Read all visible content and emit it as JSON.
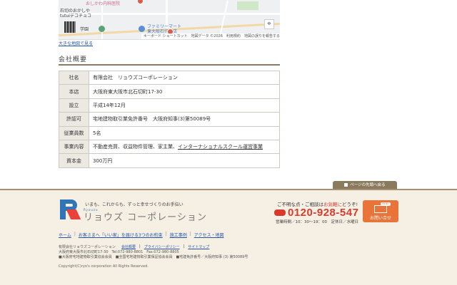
{
  "map": {
    "poi": {
      "shop1": "おしかわ内科医院",
      "shop2a": "石切のおかしや",
      "shop2b": "tutuiデコチョコ",
      "school": "学園",
      "mart_line1": "ファミリーマート",
      "mart_line2": "東大阪石切町店"
    },
    "controls": {
      "locate": "⌖"
    },
    "attribution": [
      "キーボード ショートカット",
      "地図データ ©2026",
      "利用規約",
      "地図の誤りを報告する"
    ]
  },
  "map_link": "大きな地図で見る",
  "section": {
    "title": "会社概要"
  },
  "company": [
    {
      "label": "社名",
      "value": "有限会社　リョウズコーポレーション"
    },
    {
      "label": "本店",
      "value": "大阪府東大阪市北石切町17-30"
    },
    {
      "label": "設立",
      "value": "平成14年12月"
    },
    {
      "label": "許認可",
      "value": "宅地建物取引業免許番号　大阪府知事(3)第50089号"
    },
    {
      "label": "従業員数",
      "value": "5名"
    },
    {
      "label": "事業内容",
      "value": "不動産売買、収益物件管理、家主業、",
      "link": "インターナショナルスクール運営事業"
    },
    {
      "label": "資本金",
      "value": "300万円"
    }
  ],
  "pagetop": "ページの先頭へ戻る",
  "footer": {
    "tagline": "いまも、これからも、ずっと幸せづくりのお手伝い",
    "brand_en": "Ryouzu",
    "brand": "リョウズ コーポレーション",
    "contact_lead_1": "ご不明な点・ご相談は",
    "contact_lead_2": "お気軽に",
    "contact_lead_3": "どうぞ!",
    "freedial": "0120-928-547",
    "hours": "営業時間／10：30～19：00　定休日／水曜日",
    "mail_tag": "mail",
    "mail_label": "お問い合せ",
    "nav": [
      "ホーム",
      "お客さまへ「いい家」を届ける3つのお約束",
      "施工事例",
      "アクセス・地図"
    ],
    "links2": [
      "会社概要",
      "プライバシーポリシー",
      "サイトマップ"
    ],
    "info": [
      "有限会社リョウズコーポレーション",
      "大阪府東大阪市北石切町17-30　Tel:072-980-8801　Fax:072-980-8805",
      "■大阪府宅地建物取引業協会会員　■全国宅地建物取引業保証協会会員　■宅建免許番号／大阪府知事 (3) 第50089号"
    ],
    "copyright": "Copyright(C)ryo's corporation All Rights Reserved."
  }
}
